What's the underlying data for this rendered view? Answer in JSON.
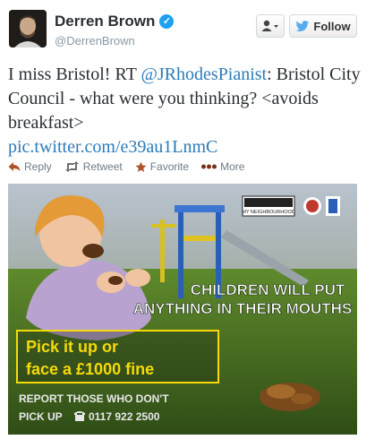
{
  "profile": {
    "name": "Derren Brown",
    "handle": "@DerrenBrown",
    "verified_icon": "verified-badge-icon"
  },
  "buttons": {
    "user_menu_icon": "user-dropdown-icon",
    "follow_label": "Follow"
  },
  "tweet": {
    "part1": "I miss Bristol!  RT ",
    "mention": "@JRhodesPianist",
    "part2": ": Bristol City Council - what were you thinking? <avoids breakfast>",
    "link": "pic.twitter.com/e39au1LnmC"
  },
  "actions": {
    "reply": "Reply",
    "retweet": "Retweet",
    "favorite": "Favorite",
    "more": "More"
  },
  "image": {
    "logo_text": "MY NEIGHBOURHOOD",
    "headline_line1": "CHILDREN WILL PUT",
    "headline_line2": "ANYTHING IN THEIR MOUTHS",
    "warning_line1": "Pick it up or",
    "warning_line2": "face a £1000 fine",
    "report_line": "REPORT THOSE WHO DON'T",
    "pickup_text": "PICK UP",
    "phone": "0117 922 2500"
  },
  "colors": {
    "link": "#2b7bb9",
    "verified": "#1da1f2",
    "muted": "#8899a6",
    "warning_yellow": "#f5d90a"
  }
}
